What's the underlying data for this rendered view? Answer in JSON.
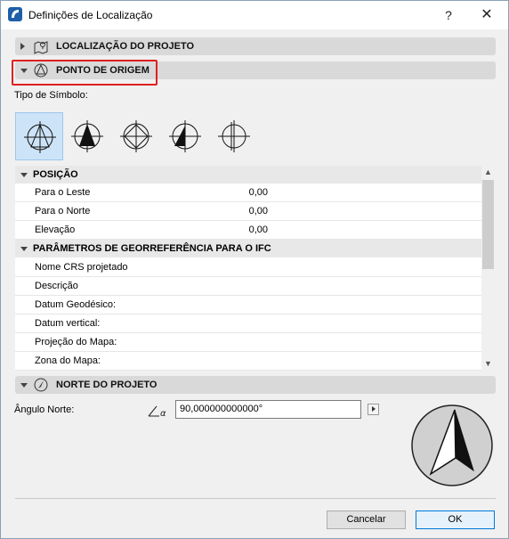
{
  "window": {
    "title": "Definições de Localização",
    "help_label": "?",
    "close_label": "✕"
  },
  "sections": {
    "project_location": {
      "label": "LOCALIZAÇÃO DO PROJETO",
      "expanded": false,
      "icon": "map-pin-icon"
    },
    "origin_point": {
      "label": "PONTO DE ORIGEM",
      "expanded": true,
      "icon": "survey-point-icon"
    },
    "project_north": {
      "label": "NORTE DO PROJETO",
      "expanded": true,
      "icon": "north-compass-icon"
    }
  },
  "symbol_type": {
    "label": "Tipo de Símbolo:",
    "options": [
      {
        "name": "symbol-crosshair-triangle-outline",
        "selected": true
      },
      {
        "name": "symbol-crosshair-triangle-filled",
        "selected": false
      },
      {
        "name": "symbol-crosshair-diamond",
        "selected": false
      },
      {
        "name": "symbol-crosshair-half-filled",
        "selected": false
      },
      {
        "name": "symbol-crosshair-plain",
        "selected": false
      }
    ]
  },
  "grid": {
    "position_group": "POSIÇÃO",
    "position_rows": [
      {
        "label": "Para o Leste",
        "value": "0,00"
      },
      {
        "label": "Para o Norte",
        "value": "0,00"
      },
      {
        "label": "Elevação",
        "value": "0,00"
      }
    ],
    "ifc_group": "PARÂMETROS DE GEORREFERÊNCIA PARA O IFC",
    "ifc_rows": [
      {
        "label": "Nome CRS projetado",
        "value": ""
      },
      {
        "label": "Descrição",
        "value": ""
      },
      {
        "label": "Datum Geodésico:",
        "value": ""
      },
      {
        "label": "Datum vertical:",
        "value": ""
      },
      {
        "label": "Projeção do Mapa:",
        "value": ""
      },
      {
        "label": "Zona do Mapa:",
        "value": ""
      }
    ]
  },
  "north": {
    "angle_label": "Ângulo Norte:",
    "angle_value": "90,000000000000°"
  },
  "footer": {
    "cancel_label": "Cancelar",
    "ok_label": "OK"
  },
  "colors": {
    "highlight": "#e02020",
    "selected_bg": "#cde3f7",
    "app_icon": "#1e5fa8"
  }
}
